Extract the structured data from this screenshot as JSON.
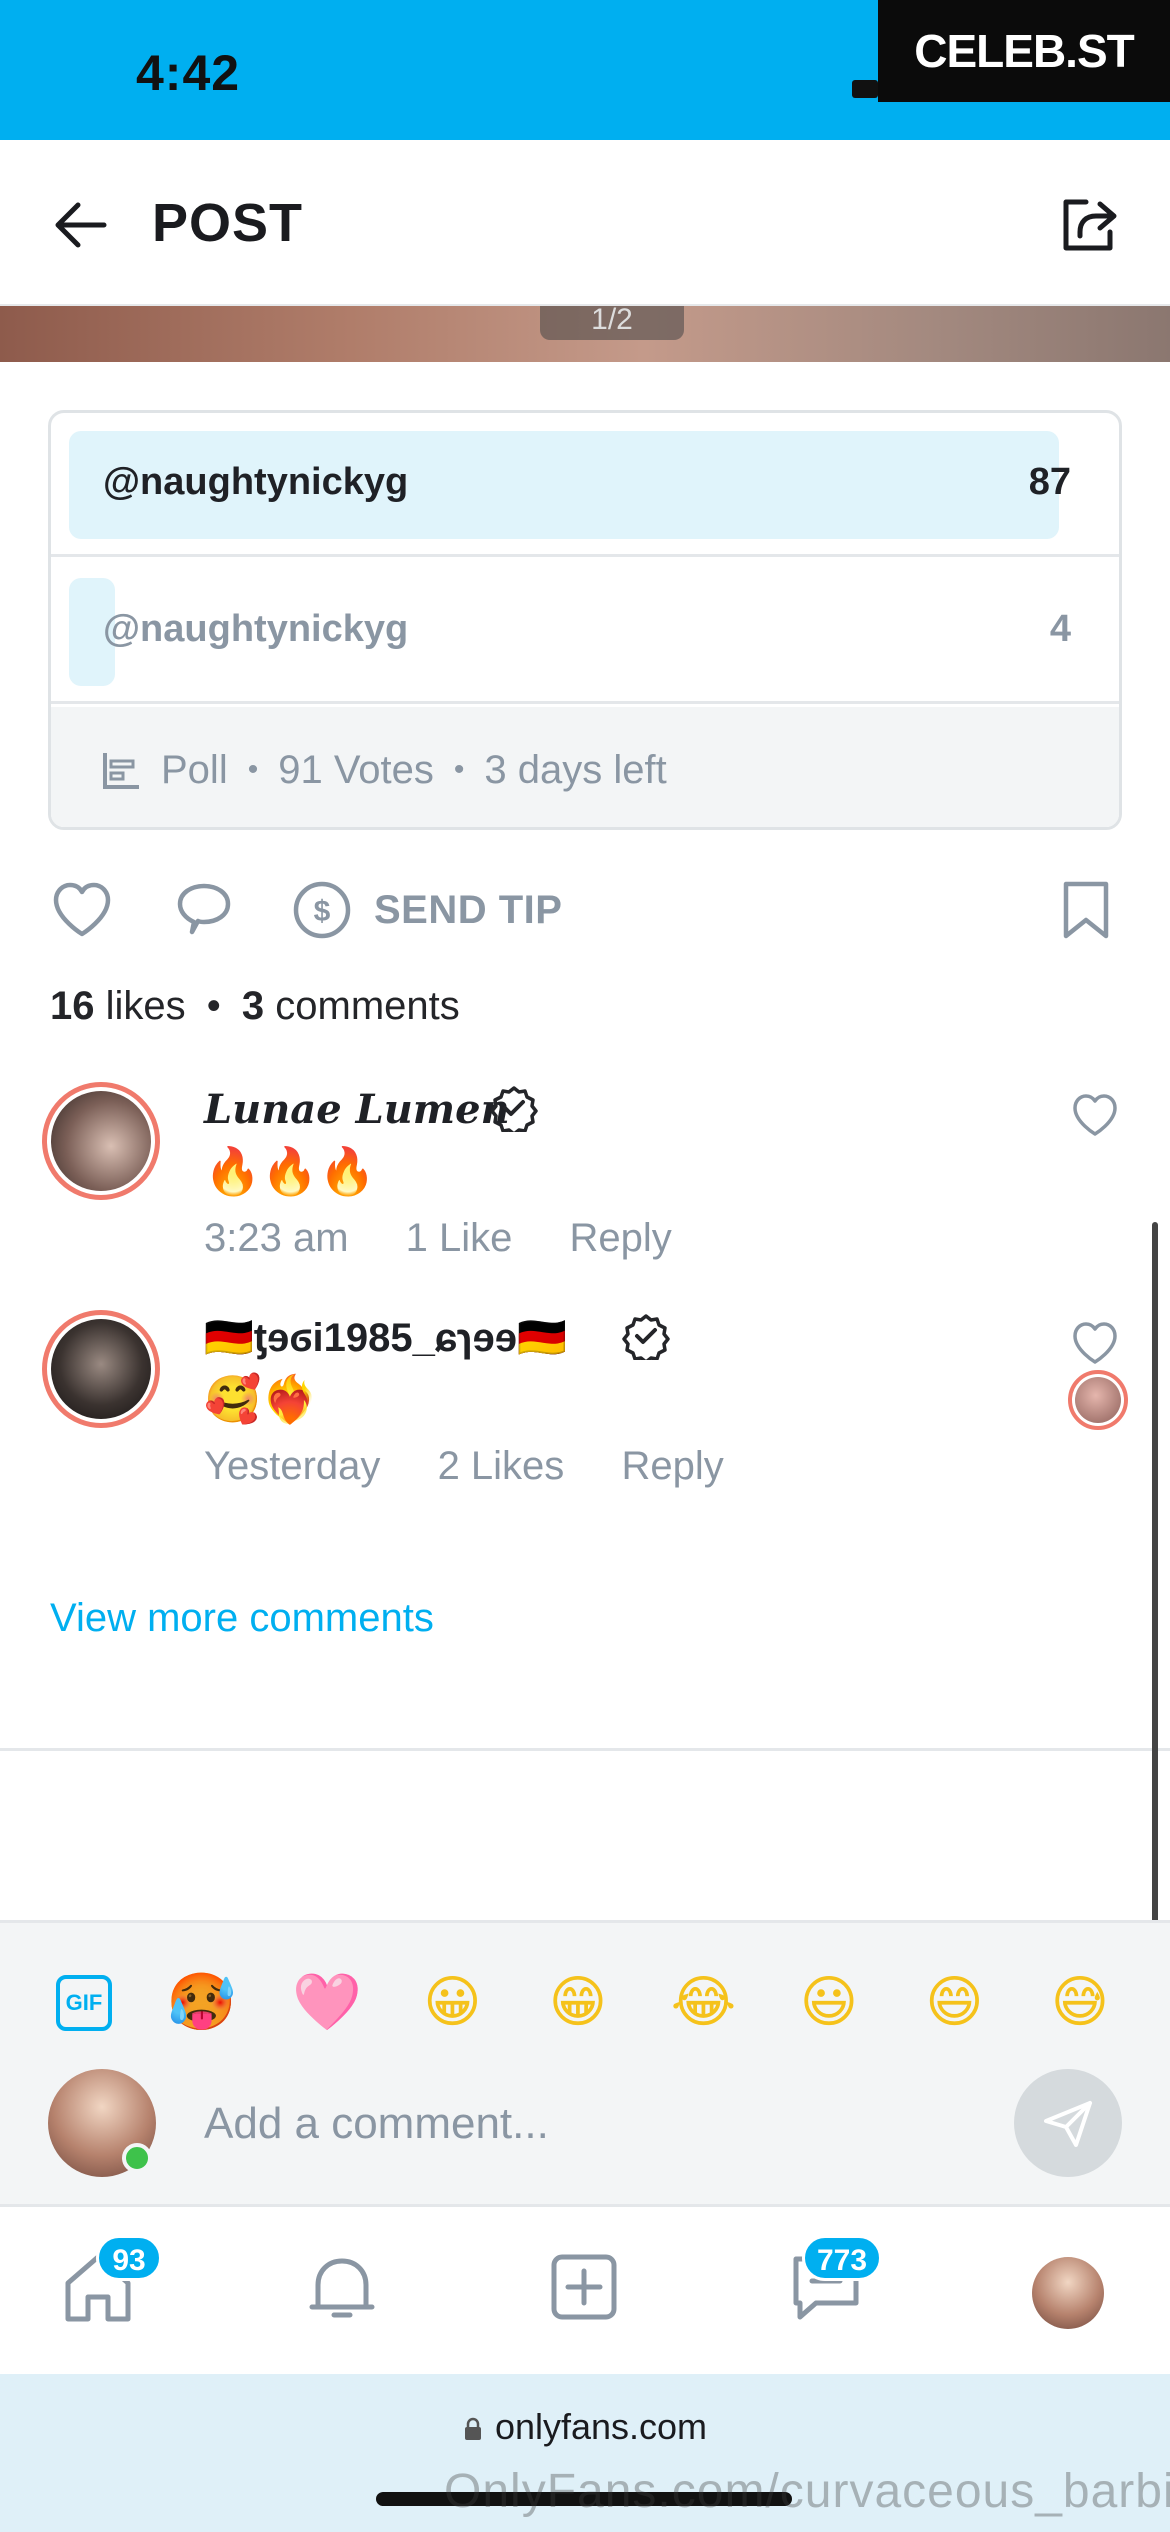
{
  "status_bar": {
    "time": "4:42",
    "badge": "CELEB.ST"
  },
  "header": {
    "title": "POST"
  },
  "media": {
    "counter": "1/2"
  },
  "poll": {
    "options": [
      {
        "label": "@naughtynickyg",
        "votes": "87",
        "share": 0.956
      },
      {
        "label": "@naughtynickyg",
        "votes": "4",
        "share": 0.044
      }
    ],
    "footer": {
      "type": "Poll",
      "votes": "91 Votes",
      "time_left": "3 days left"
    }
  },
  "actions": {
    "tip_label": "SEND TIP"
  },
  "stats": {
    "likes_count": "16",
    "likes_word": "likes",
    "comments_count": "3",
    "comments_word": "comments"
  },
  "comments": [
    {
      "name": "Lunae Lumen",
      "text": "🔥🔥🔥",
      "time": "3:23 am",
      "likes": "1 Like",
      "reply": "Reply"
    },
    {
      "name": "🇩🇪ƫɘϭi1985_ɕɿɘɘ🇩🇪",
      "text": "🥰❤️‍🔥",
      "time": "Yesterday",
      "likes": "2 Likes",
      "reply": "Reply"
    }
  ],
  "view_more": "View more comments",
  "composer": {
    "gif_label": "GIF",
    "emojis": [
      "🥵",
      "🩷",
      "😀",
      "😁",
      "😂",
      "😃",
      "😄",
      "😅"
    ],
    "placeholder": "Add a comment..."
  },
  "tabbar": {
    "home_badge": "93",
    "messages_badge": "773"
  },
  "browser": {
    "url": "onlyfans.com",
    "watermark": "OnlyFans.com/curvaceous_barbie"
  },
  "colors": {
    "accent": "#00aff0",
    "muted": "#8a96a3",
    "poll_fill": "#e0f4fb",
    "avatar_ring": "#f07a6c",
    "online": "#3ec24b"
  }
}
